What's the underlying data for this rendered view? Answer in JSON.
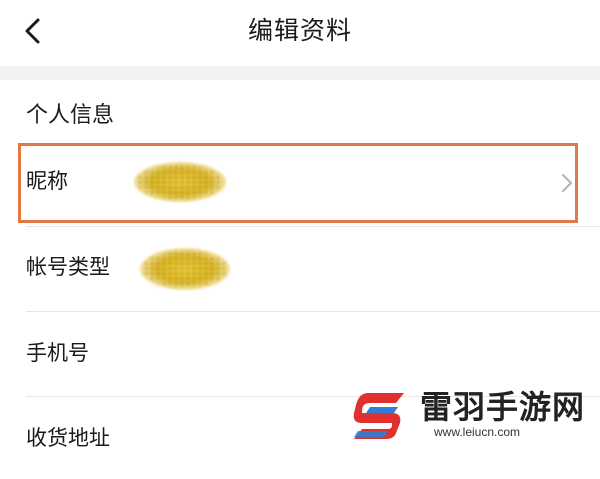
{
  "header": {
    "title": "编辑资料",
    "back_icon": "chevron-left-icon"
  },
  "section": {
    "title": "个人信息"
  },
  "rows": [
    {
      "label": "昵称",
      "value_obscured": true,
      "has_chevron": true
    },
    {
      "label": "帐号类型",
      "value_obscured": true
    },
    {
      "label": "手机号"
    },
    {
      "label": "收货地址"
    }
  ],
  "highlight_color": "#e07a42",
  "watermark": {
    "name": "雷羽手游网",
    "url": "www.leiucn.com"
  }
}
